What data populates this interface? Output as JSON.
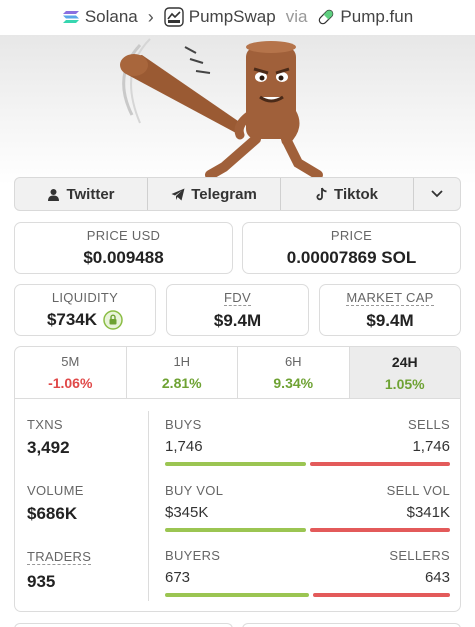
{
  "breadcrumb": {
    "chain": "Solana",
    "dex": "PumpSwap",
    "via": "via",
    "launchpad": "Pump.fun"
  },
  "socials": [
    {
      "label": "Twitter",
      "icon": "user-icon"
    },
    {
      "label": "Telegram",
      "icon": "telegram-icon"
    },
    {
      "label": "Tiktok",
      "icon": "tiktok-icon"
    }
  ],
  "price": {
    "usd_label": "PRICE USD",
    "usd_value": "$0.009488",
    "native_label": "PRICE",
    "native_value": "0.00007869 SOL"
  },
  "metrics": {
    "liquidity_label": "LIQUIDITY",
    "liquidity_value": "$734K",
    "fdv_label": "FDV",
    "fdv_value": "$9.4M",
    "mcap_label": "MARKET CAP",
    "mcap_value": "$9.4M"
  },
  "timeframes": [
    {
      "label": "5M",
      "value": "-1.06%",
      "trend": "down"
    },
    {
      "label": "1H",
      "value": "2.81%",
      "trend": "up"
    },
    {
      "label": "6H",
      "value": "9.34%",
      "trend": "up"
    },
    {
      "label": "24H",
      "value": "1.05%",
      "trend": "up",
      "active": true
    }
  ],
  "stats": {
    "txns_label": "TXNS",
    "txns_value": "3,492",
    "volume_label": "VOLUME",
    "volume_value": "$686K",
    "traders_label": "TRADERS",
    "traders_value": "935",
    "buys_label": "BUYS",
    "buys_value": "1,746",
    "sells_label": "SELLS",
    "sells_value": "1,746",
    "buys_share": 0.5,
    "buy_vol_label": "BUY VOL",
    "buy_vol_value": "$345K",
    "sell_vol_label": "SELL VOL",
    "sell_vol_value": "$341K",
    "buy_vol_share": 0.503,
    "buyers_label": "BUYERS",
    "buyers_value": "673",
    "sellers_label": "SELLERS",
    "sellers_value": "643",
    "buyers_share": 0.511
  },
  "colors": {
    "positive": "#6ea233",
    "negative": "#e04848",
    "buy_bar": "#9bc552",
    "sell_bar": "#e35a5a"
  }
}
